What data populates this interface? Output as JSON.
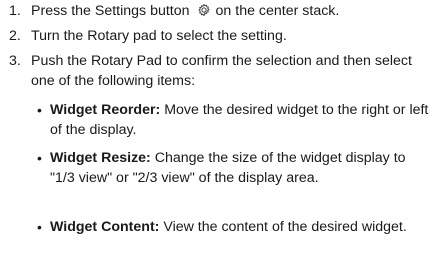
{
  "steps": [
    {
      "number": "1.",
      "text_before": "Press the Settings button",
      "icon": "settings-gear-icon",
      "text_after": "on the center stack."
    },
    {
      "number": "2.",
      "text": "Turn the Rotary pad to select the setting."
    },
    {
      "number": "3.",
      "text": "Push the Rotary Pad to confirm the selection and then select one of the following items:"
    }
  ],
  "items": [
    {
      "bullet": "•",
      "term": "Widget Reorder:",
      "description": "Move the desired widget to the right or left of the display."
    },
    {
      "bullet": "•",
      "term": "Widget Resize:",
      "description": "Change the size of the widget display to \"1/3 view\" or \"2/3 view\" of the display area."
    },
    {
      "bullet": "•",
      "term": "Widget Content:",
      "description": "View the content of the desired widget."
    }
  ]
}
